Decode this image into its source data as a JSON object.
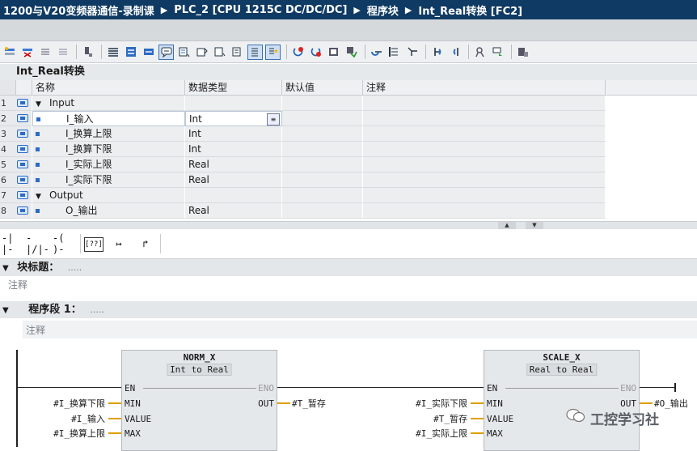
{
  "titlebar": {
    "crumbs": [
      "1200与V20变频器通信-录制课",
      "PLC_2 [CPU 1215C DC/DC/DC]",
      "程序块",
      "Int_Real转换 [FC2]"
    ],
    "separator": "▶"
  },
  "toolbar_icons": [
    "insert-row-icon",
    "delete-row-icon",
    "insert-net-icon",
    "delete-net-icon",
    "download-icon",
    "list-view-icon",
    "block-view-icon",
    "network-view-icon",
    "comments-icon",
    "select-icon",
    "favorites-icon",
    "ladder-element-icon",
    "abs-icon",
    "goto-icon",
    "goto-prev-icon",
    "goto-next-icon",
    "monitor-icon",
    "break-icon",
    "stop-icon",
    "open-icon",
    "compare-icon",
    "call-icon",
    "return-icon",
    "dbg-icon",
    "dbg2-icon",
    "key-icon",
    "snapshot-icon",
    "lock-icon"
  ],
  "interface": {
    "title": "Int_Real转换",
    "columns": [
      "名称",
      "数据类型",
      "默认值",
      "注释"
    ],
    "rows": [
      {
        "num": "1",
        "name": "Input",
        "type": "",
        "section": true
      },
      {
        "num": "2",
        "name": "I_输入",
        "type": "Int",
        "section": false,
        "editing": true
      },
      {
        "num": "3",
        "name": "I_换算上限",
        "type": "Int",
        "section": false
      },
      {
        "num": "4",
        "name": "I_换算下限",
        "type": "Int",
        "section": false
      },
      {
        "num": "5",
        "name": "I_实际上限",
        "type": "Real",
        "section": false
      },
      {
        "num": "6",
        "name": "I_实际下限",
        "type": "Real",
        "section": false
      },
      {
        "num": "7",
        "name": "Output",
        "type": "",
        "section": true
      },
      {
        "num": "8",
        "name": "O_输出",
        "type": "Real",
        "section": false
      }
    ]
  },
  "ladder_toolbar": [
    "-| |-",
    "-|/|-",
    "-( )-",
    "[??]",
    "↦",
    "↱"
  ],
  "block_title": {
    "label": "块标题：",
    "dots": ".....",
    "comment": "注释"
  },
  "network": {
    "label": "程序段 1：",
    "dots": ".....",
    "comment": "注释"
  },
  "boxes": [
    {
      "name": "NORM_X",
      "types": [
        "Int",
        "to",
        "Real"
      ],
      "en": "EN",
      "eno": "ENO",
      "inputs": [
        {
          "pin": "MIN",
          "operand": "#I_换算下限"
        },
        {
          "pin": "VALUE",
          "operand": "#I_输入"
        },
        {
          "pin": "MAX",
          "operand": "#I_换算上限"
        }
      ],
      "output": {
        "pin": "OUT",
        "operand": "#T_暂存"
      }
    },
    {
      "name": "SCALE_X",
      "types": [
        "Real",
        "to",
        "Real"
      ],
      "en": "EN",
      "eno": "ENO",
      "inputs": [
        {
          "pin": "MIN",
          "operand": "#I_实际下限"
        },
        {
          "pin": "VALUE",
          "operand": "#T_暂存"
        },
        {
          "pin": "MAX",
          "operand": "#I_实际上限"
        }
      ],
      "output": {
        "pin": "OUT",
        "operand": "#O_输出"
      }
    }
  ],
  "watermark": "工控学习社"
}
